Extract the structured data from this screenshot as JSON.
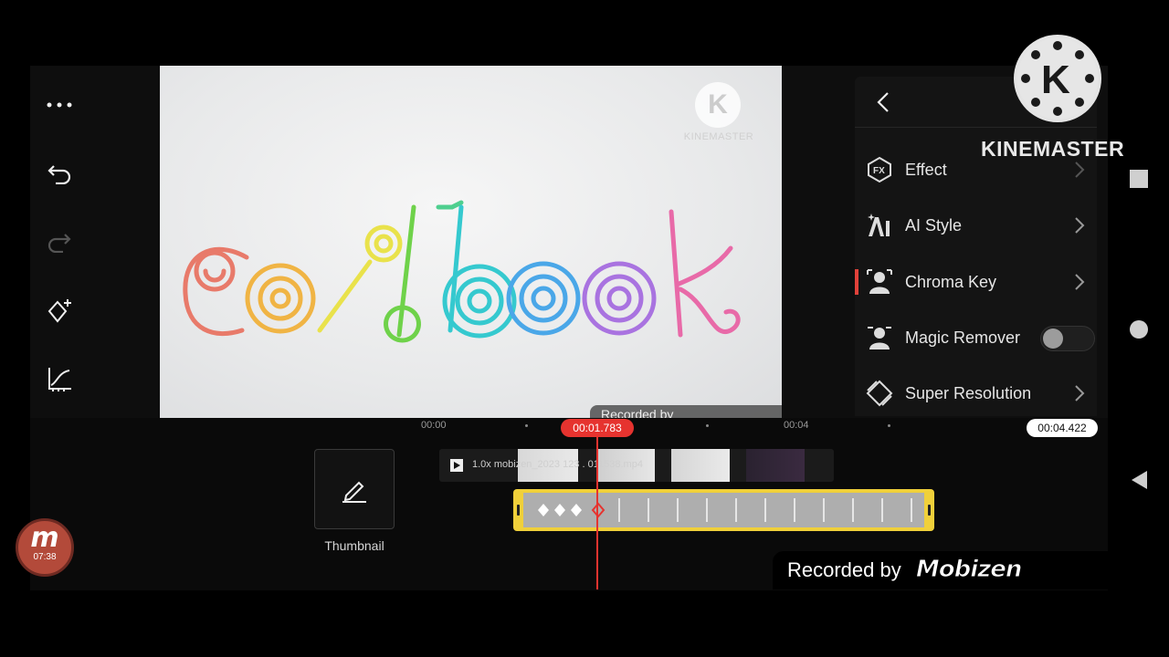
{
  "preview": {
    "title_text": "coolbook",
    "watermark_label": "KINEMASTER",
    "recorder_text": "Recorded by"
  },
  "panel": {
    "items": [
      {
        "label": "Effect",
        "icon": "fx-icon"
      },
      {
        "label": "AI Style",
        "icon": "ai-style-icon"
      },
      {
        "label": "Chroma Key",
        "icon": "chroma-key-icon",
        "active": true
      },
      {
        "label": "Magic Remover",
        "icon": "magic-remover-icon",
        "toggle": false
      },
      {
        "label": "Super Resolution",
        "icon": "super-resolution-icon"
      }
    ]
  },
  "overlay": {
    "brand": "KINEMASTER"
  },
  "timeline": {
    "ruler": [
      "00:00",
      "00:04"
    ],
    "playhead_time": "00:01.783",
    "total_time": "00:04.422",
    "video_clip_label": "1.0x mobizen_2023 123 . 011538.mp4"
  },
  "thumbnail_button": {
    "label": "Thumbnail"
  },
  "recorder": {
    "text": "Recorded by",
    "brand": "Mobizen",
    "badge_time": "07:38"
  },
  "colors": {
    "accent_red": "#e6332f",
    "layer_yellow": "#f0d03a",
    "panel_bg": "#141414"
  }
}
